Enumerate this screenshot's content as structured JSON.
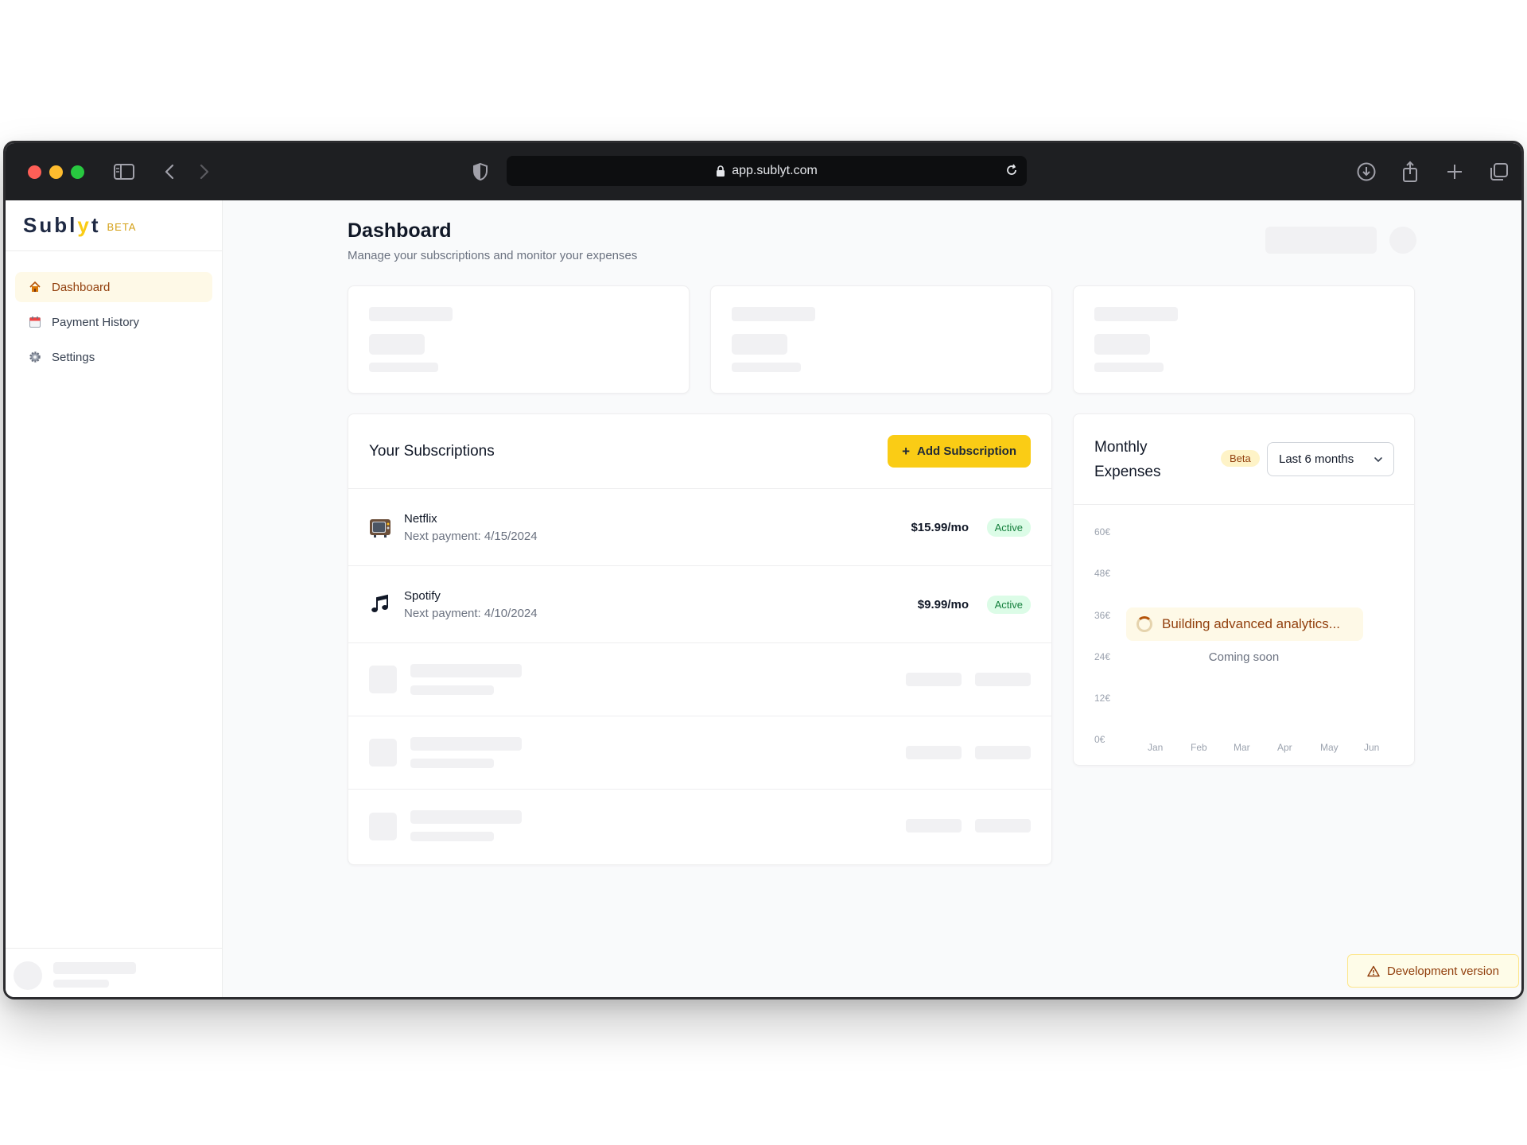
{
  "browser": {
    "url": "app.sublyt.com"
  },
  "brand": {
    "logo_pre": "Subl",
    "logo_y": "y",
    "logo_post": "t",
    "logo_tag": "BETA",
    "accent": "#facc15"
  },
  "sidebar": {
    "items": [
      {
        "label": "Dashboard",
        "icon": "house-icon",
        "active": true
      },
      {
        "label": "Payment History",
        "icon": "calendar-icon",
        "active": false
      },
      {
        "label": "Settings",
        "icon": "gear-icon",
        "active": false
      }
    ]
  },
  "header": {
    "title": "Dashboard",
    "subtitle": "Manage your subscriptions and monitor your expenses"
  },
  "subscriptions": {
    "title": "Your Subscriptions",
    "add_label": "Add Subscription",
    "items": [
      {
        "name": "Netflix",
        "next": "Next payment: 4/15/2024",
        "price": "$15.99/mo",
        "status": "Active",
        "icon": "tv-icon"
      },
      {
        "name": "Spotify",
        "next": "Next payment: 4/10/2024",
        "price": "$9.99/mo",
        "status": "Active",
        "icon": "music-note-icon"
      }
    ]
  },
  "expenses": {
    "title": "Monthly Expenses",
    "badge": "Beta",
    "range": "Last 6 months",
    "loading": "Building advanced analytics...",
    "coming_soon": "Coming soon",
    "y_ticks": [
      "60€",
      "48€",
      "36€",
      "24€",
      "12€",
      "0€"
    ],
    "x_ticks": [
      "Jan",
      "Feb",
      "Mar",
      "Apr",
      "May",
      "Jun"
    ]
  },
  "footer": {
    "dev_label": "Development version"
  }
}
